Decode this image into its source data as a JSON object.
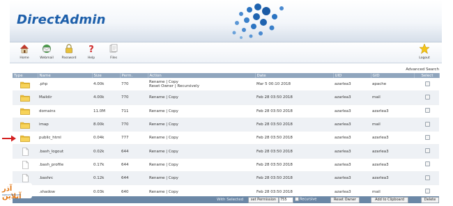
{
  "app": {
    "logo_text": "DirectAdmin"
  },
  "toolbar": {
    "items": [
      {
        "label": "Home",
        "icon": "home-icon"
      },
      {
        "label": "Webmail",
        "icon": "webmail-icon"
      },
      {
        "label": "Password",
        "icon": "lock-icon"
      },
      {
        "label": "Help",
        "icon": "help-icon"
      },
      {
        "label": "Files",
        "icon": "files-icon"
      }
    ],
    "logout": {
      "label": "Logout",
      "icon": "star-icon"
    }
  },
  "advanced_search": "Advanced Search",
  "table": {
    "headers": [
      "Type",
      "Name",
      "Size",
      "Perm.",
      "Action",
      "Date",
      "UID",
      "GID",
      "Select"
    ],
    "rows": [
      {
        "type": "folder",
        "name": ".php",
        "size": "4.00k",
        "perm": "770",
        "action1": "Rename | Copy",
        "action2": "Reset Owner | Recursively",
        "date": "Mar 5 00:10 2018",
        "uid": "azarlea3",
        "gid": "apache"
      },
      {
        "type": "folder",
        "name": "Maildir",
        "size": "4.00k",
        "perm": "770",
        "action1": "Rename | Copy",
        "action2": "",
        "date": "Feb 28 03:50 2018",
        "uid": "azarlea3",
        "gid": "mail"
      },
      {
        "type": "folder",
        "name": "domains",
        "size": "11.0M",
        "perm": "711",
        "action1": "Rename | Copy",
        "action2": "",
        "date": "Feb 28 03:50 2018",
        "uid": "azarlea3",
        "gid": "azarlea3"
      },
      {
        "type": "folder",
        "name": "imap",
        "size": "8.00k",
        "perm": "770",
        "action1": "Rename | Copy",
        "action2": "",
        "date": "Feb 28 03:50 2018",
        "uid": "azarlea3",
        "gid": "mail"
      },
      {
        "type": "folder",
        "name": "public_html",
        "size": "0.04k",
        "perm": "777",
        "action1": "Rename | Copy",
        "action2": "",
        "date": "Feb 28 03:50 2018",
        "uid": "azarlea3",
        "gid": "azarlea3"
      },
      {
        "type": "file",
        "name": ".bash_logout",
        "size": "0.02k",
        "perm": "644",
        "action1": "Rename | Copy",
        "action2": "",
        "date": "Feb 28 03:50 2018",
        "uid": "azarlea3",
        "gid": "azarlea3"
      },
      {
        "type": "file",
        "name": ".bash_profile",
        "size": "0.17k",
        "perm": "644",
        "action1": "Rename | Copy",
        "action2": "",
        "date": "Feb 28 03:50 2018",
        "uid": "azarlea3",
        "gid": "azarlea3"
      },
      {
        "type": "file",
        "name": ".bashrc",
        "size": "0.12k",
        "perm": "644",
        "action1": "Rename | Copy",
        "action2": "",
        "date": "Feb 28 03:50 2018",
        "uid": "azarlea3",
        "gid": "azarlea3"
      },
      {
        "type": "file",
        "name": ".shadow",
        "size": "0.03k",
        "perm": "640",
        "action1": "Rename | Copy",
        "action2": "",
        "date": "Feb 28 03:50 2018",
        "uid": "azarlea3",
        "gid": "mail"
      }
    ]
  },
  "footer": {
    "with_selected": "With Selected",
    "set_permission_label": "set Permission",
    "permission_value": "755",
    "recursive_label": "Recursive",
    "reset_owner_label": "Reset Owner",
    "add_clipboard_label": "Add to Clipboard",
    "delete_label": "Delete"
  },
  "watermark": {
    "text": "آذر آنلاین",
    "subtext": "azaronline.com"
  },
  "colors": {
    "header_bar": "#8fa5bd",
    "footer_bar": "#6b87a6",
    "logo": "#1d5faa",
    "folder": "#f2c23a",
    "arrow": "#d42020"
  }
}
